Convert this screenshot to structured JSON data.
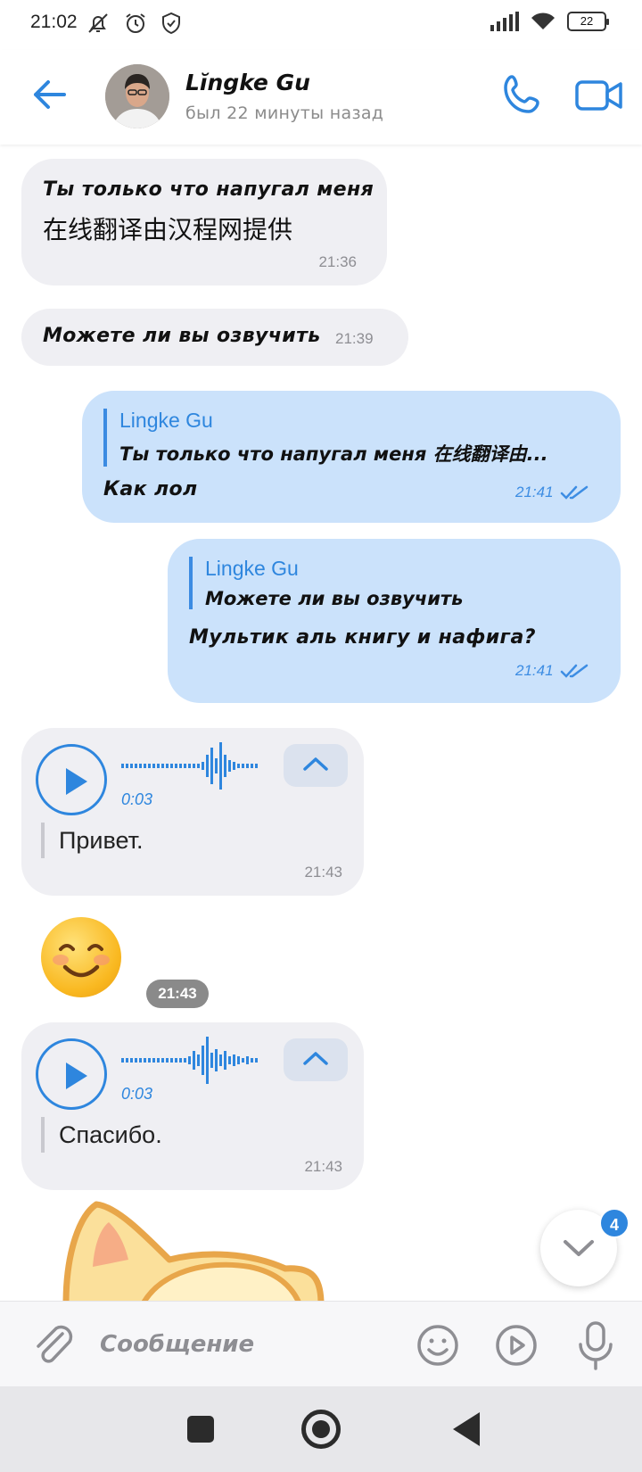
{
  "status_bar": {
    "time": "21:02",
    "battery": "22",
    "icons": [
      "mute-icon",
      "alarm-icon",
      "shield-icon",
      "signal-icon",
      "wifi-icon",
      "battery-icon"
    ]
  },
  "header": {
    "contact_name": "Lĭngke Gu",
    "status": "был 22 минуты назад",
    "icons": [
      "back-arrow-icon",
      "phone-icon",
      "video-icon"
    ],
    "accent": "#2e86de"
  },
  "messages": [
    {
      "dir": "in",
      "line1": "Ты только что напугал меня",
      "line2": "在线翻译由汉程网提供",
      "time": "21:36"
    },
    {
      "dir": "in",
      "text": "Можете ли вы озвучить",
      "time": "21:39"
    },
    {
      "dir": "out",
      "reply_name": "Lingke Gu",
      "reply_text": "Ты только что напугал меня 在线翻译由...",
      "text": "Как лол",
      "time": "21:41"
    },
    {
      "dir": "out",
      "reply_name": "Lingke Gu",
      "reply_text": "Можете ли вы озвучить",
      "text": "Мультик аль книгу и нафига?",
      "time": "21:41"
    },
    {
      "dir": "in",
      "type": "voice",
      "duration": "0:03",
      "transcript": "Привет.",
      "time": "21:43"
    },
    {
      "dir": "in",
      "type": "emoji",
      "emoji": "smiling-face-emoji",
      "time": "21:43"
    },
    {
      "dir": "in",
      "type": "voice",
      "duration": "0:03",
      "transcript": "Спасибо.",
      "time": "21:43"
    },
    {
      "dir": "in",
      "type": "sticker",
      "sticker": "cat-sticker"
    }
  ],
  "scroll_down": {
    "badge": "4"
  },
  "composer": {
    "placeholder": "Сообщение",
    "icons": [
      "attach-icon",
      "emoji-icon",
      "sticker-icon",
      "mic-icon"
    ]
  },
  "nav_bar": {
    "icons": [
      "recents-icon",
      "home-icon",
      "back-icon"
    ]
  },
  "colors": {
    "outgoing_bubble": "#cbe2fb",
    "incoming_bubble": "#efeff3",
    "accent": "#2e86de"
  }
}
